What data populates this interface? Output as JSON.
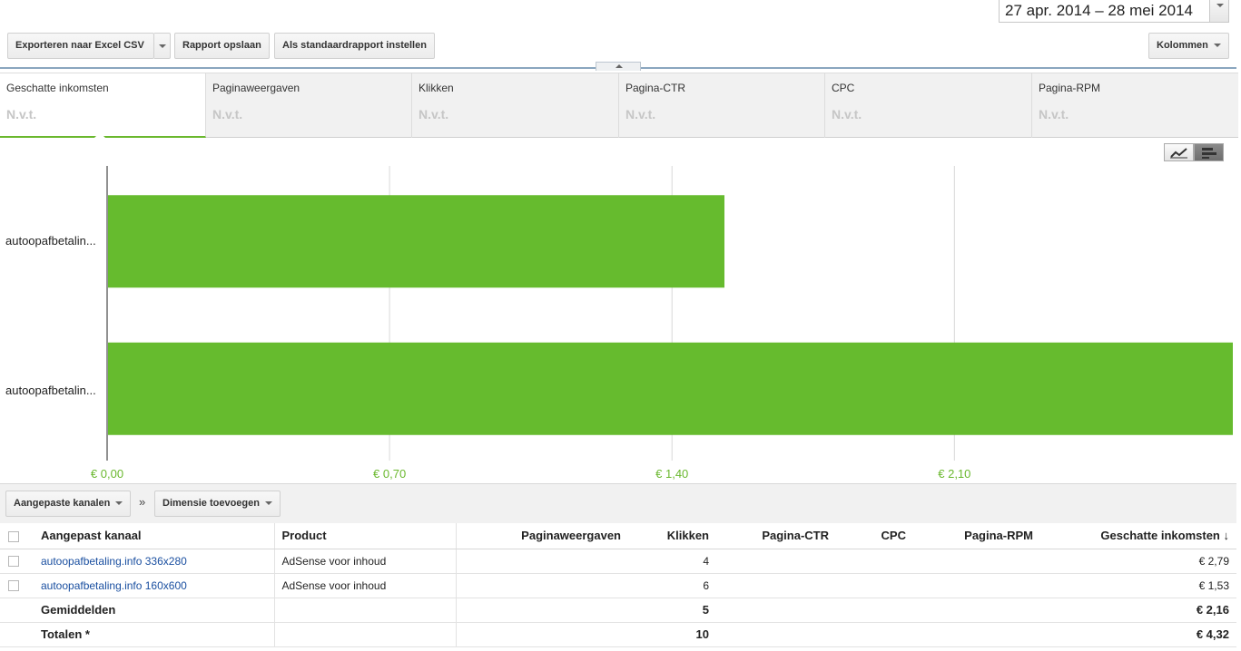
{
  "date_range": "27 apr. 2014 – 28 mei 2014",
  "toolbar": {
    "export_label": "Exporteren naar Excel CSV",
    "save_label": "Rapport opslaan",
    "default_label": "Als standaardrapport instellen",
    "columns_label": "Kolommen"
  },
  "metrics": [
    {
      "label": "Geschatte inkomsten",
      "value": "N.v.t."
    },
    {
      "label": "Paginaweergaven",
      "value": "N.v.t."
    },
    {
      "label": "Klikken",
      "value": "N.v.t."
    },
    {
      "label": "Pagina-CTR",
      "value": "N.v.t."
    },
    {
      "label": "CPC",
      "value": "N.v.t."
    },
    {
      "label": "Pagina-RPM",
      "value": "N.v.t."
    }
  ],
  "chart_data": {
    "type": "bar",
    "orientation": "horizontal",
    "categories": [
      "autoopafbetalin...",
      "autoopafbetalin..."
    ],
    "values": [
      1.53,
      2.79
    ],
    "tick_labels": [
      "€ 0,00",
      "€ 0,70",
      "€ 1,40",
      "€ 2,10"
    ],
    "ticks": [
      0,
      0.7,
      1.4,
      2.1
    ],
    "xlim": [
      0,
      2.79
    ],
    "bar_color": "#66bb2e",
    "grid": true
  },
  "table_bar": {
    "dimension_label": "Aangepaste kanalen",
    "separator": "»",
    "add_dimension_label": "Dimensie toevoegen"
  },
  "table": {
    "headers": {
      "channel": "Aangepast kanaal",
      "product": "Product",
      "pageviews": "Paginaweergaven",
      "clicks": "Klikken",
      "ctr": "Pagina-CTR",
      "cpc": "CPC",
      "rpm": "Pagina-RPM",
      "earnings": "Geschatte inkomsten ↓"
    },
    "rows": [
      {
        "channel": "autoopafbetaling.info 336x280",
        "product": "AdSense voor inhoud",
        "clicks": "4",
        "earnings": "€ 2,79"
      },
      {
        "channel": "autoopafbetaling.info 160x600",
        "product": "AdSense voor inhoud",
        "clicks": "6",
        "earnings": "€ 1,53"
      }
    ],
    "averages": {
      "label": "Gemiddelden",
      "clicks": "5",
      "earnings": "€ 2,16"
    },
    "totals": {
      "label": "Totalen *",
      "clicks": "10",
      "earnings": "€ 4,32"
    }
  }
}
